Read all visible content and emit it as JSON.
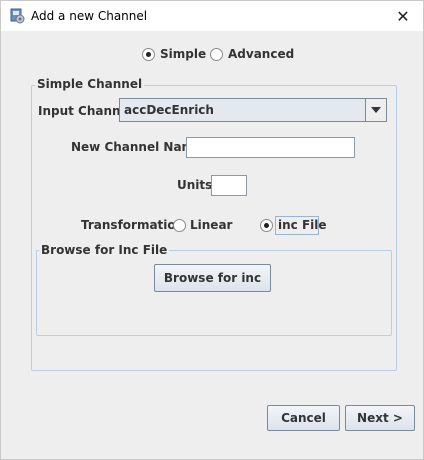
{
  "window": {
    "title": "Add a new Channel",
    "close_label": "✕"
  },
  "mode": {
    "simple_label": "Simple",
    "advanced_label": "Advanced",
    "selected": "Simple"
  },
  "simple_channel": {
    "group_title": "Simple Channel",
    "input_channel_label": "Input Channel",
    "input_channel_value": "accDecEnrich",
    "new_channel_name_label": "New Channel Name",
    "new_channel_name_value": "",
    "units_label": "Units",
    "units_value": "",
    "transformation_label": "Transformation",
    "linear_label": "Linear",
    "inc_file_label": "inc File",
    "transformation_selected": "inc File"
  },
  "browse": {
    "group_title": "Browse for Inc File",
    "button_label": "Browse for inc"
  },
  "footer": {
    "cancel_label": "Cancel",
    "next_label": "Next >"
  }
}
